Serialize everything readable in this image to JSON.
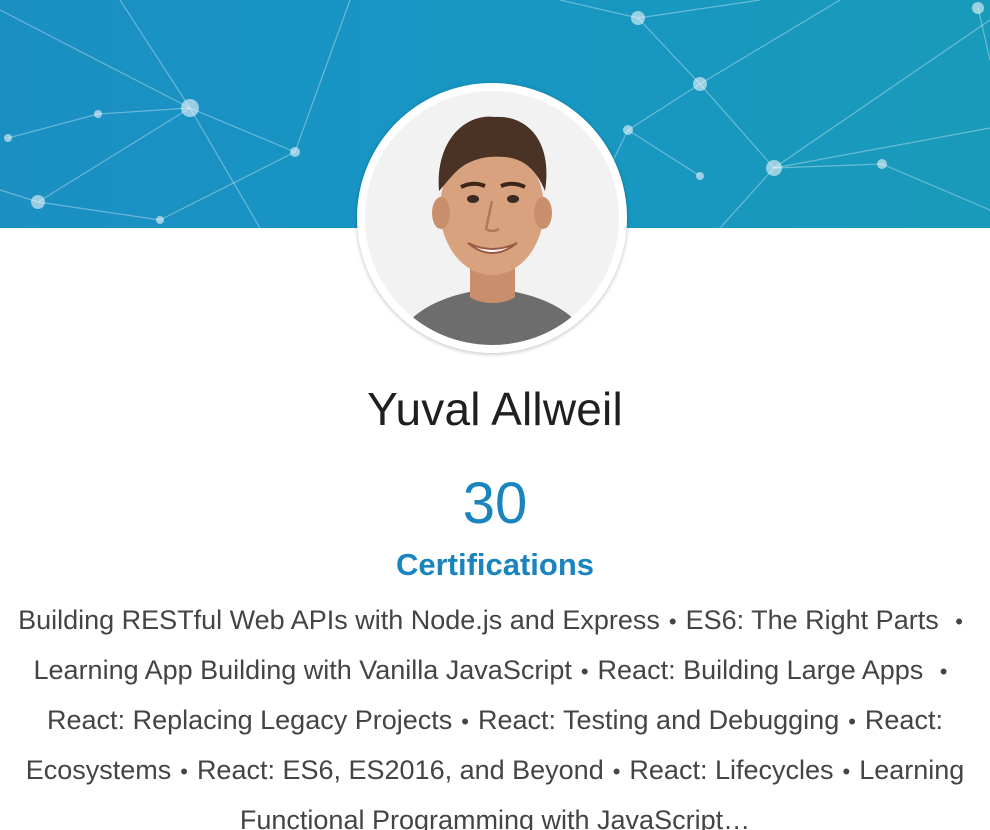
{
  "profile": {
    "name": "Yuval Allweil",
    "avatar_icon": "profile-photo",
    "certification_count": "30",
    "certification_label": "Certifications"
  },
  "certifications": [
    "Building RESTful Web APIs with Node.js and Express",
    "ES6: The Right Parts",
    "Learning App Building with Vanilla JavaScript",
    "React: Building Large Apps",
    "React: Replacing Legacy Projects",
    "React: Testing and Debugging",
    "React: Ecosystems",
    "React: ES6, ES2016, and Beyond",
    "React: Lifecycles",
    "Learning Functional Programming with JavaScript…"
  ],
  "separator": "•",
  "colors": {
    "banner": "#1b8fc2",
    "accent": "#1a84bf",
    "name_text": "#1f1f1f",
    "body_text": "#444444"
  }
}
